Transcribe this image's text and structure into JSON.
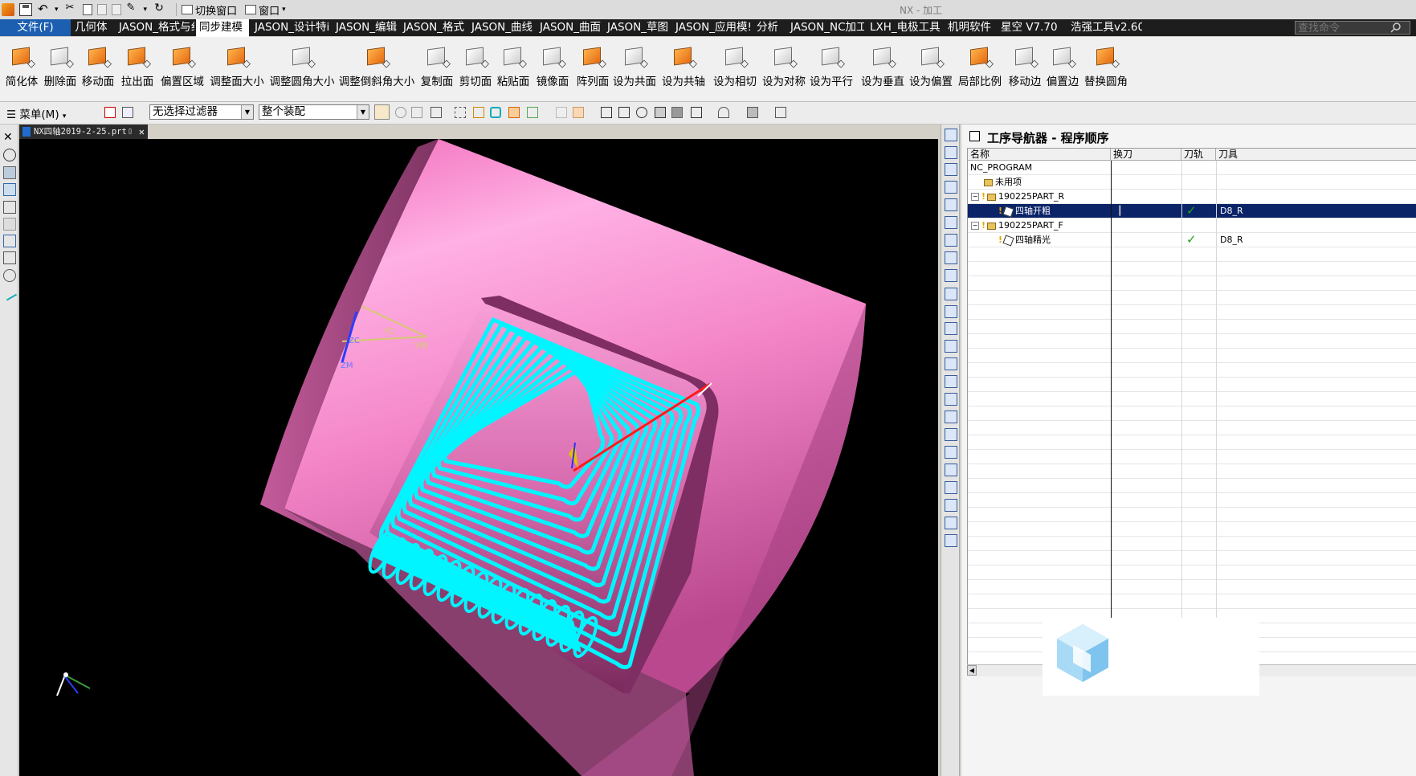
{
  "titlebar": {
    "switch_window_label": "切换窗口",
    "window_label": "窗口",
    "app_title": "NX - 加工"
  },
  "ribbon_tabs": [
    {
      "label": "文件(F)",
      "name": "tab-file"
    },
    {
      "label": "几何体",
      "name": "tab-geometry"
    },
    {
      "label": "JASON_格式与纟",
      "name": "tab-jason-format-and"
    },
    {
      "label": "同步建模",
      "name": "tab-synchronous-modeling",
      "active": true
    },
    {
      "label": "JASON_设计特i",
      "name": "tab-jason-design-feature"
    },
    {
      "label": "JASON_编辑",
      "name": "tab-jason-edit"
    },
    {
      "label": "JASON_格式",
      "name": "tab-jason-format"
    },
    {
      "label": "JASON_曲线",
      "name": "tab-jason-curve"
    },
    {
      "label": "JASON_曲面",
      "name": "tab-jason-surface"
    },
    {
      "label": "JASON_草图",
      "name": "tab-jason-sketch"
    },
    {
      "label": "JASON_应用模!",
      "name": "tab-jason-application"
    },
    {
      "label": "分析",
      "name": "tab-analysis"
    },
    {
      "label": "JASON_NC加工",
      "name": "tab-jason-nc"
    },
    {
      "label": "LXH_电极工具",
      "name": "tab-lxh-electrode"
    },
    {
      "label": "机明软件",
      "name": "tab-jiming"
    },
    {
      "label": "星空 V7.70",
      "name": "tab-xingkong"
    },
    {
      "label": "浩强工具v2.60",
      "name": "tab-haoqiang"
    }
  ],
  "search": {
    "placeholder": "查找命令"
  },
  "ribbon_commands": [
    {
      "label": "简化体",
      "name": "simplify-body-button"
    },
    {
      "label": "删除面",
      "name": "delete-face-button"
    },
    {
      "label": "移动面",
      "name": "move-face-button"
    },
    {
      "label": "拉出面",
      "name": "pull-face-button"
    },
    {
      "label": "偏置区域",
      "name": "offset-region-button"
    },
    {
      "label": "调整面大小",
      "name": "resize-face-button"
    },
    {
      "label": "调整圆角大小",
      "name": "resize-blend-button"
    },
    {
      "label": "调整倒斜角大小",
      "name": "resize-chamfer-button"
    },
    {
      "label": "复制面",
      "name": "copy-face-button"
    },
    {
      "label": "剪切面",
      "name": "cut-face-button"
    },
    {
      "label": "粘贴面",
      "name": "paste-face-button"
    },
    {
      "label": "镜像面",
      "name": "mirror-face-button"
    },
    {
      "label": "阵列面",
      "name": "pattern-face-button"
    },
    {
      "label": "设为共面",
      "name": "make-coplanar-button"
    },
    {
      "label": "设为共轴",
      "name": "make-coaxial-button"
    },
    {
      "label": "设为相切",
      "name": "make-tangent-button"
    },
    {
      "label": "设为对称",
      "name": "make-symmetric-button"
    },
    {
      "label": "设为平行",
      "name": "make-parallel-button"
    },
    {
      "label": "设为垂直",
      "name": "make-perpendicular-button"
    },
    {
      "label": "设为偏置",
      "name": "make-offset-button"
    },
    {
      "label": "局部比例",
      "name": "local-scale-button"
    },
    {
      "label": "移动边",
      "name": "move-edge-button"
    },
    {
      "label": "偏置边",
      "name": "offset-edge-button"
    },
    {
      "label": "替换圆角",
      "name": "replace-blend-button"
    }
  ],
  "selection_bar": {
    "menu_label": "菜单(M)",
    "filter_value": "无选择过滤器",
    "scope_value": "整个装配"
  },
  "document_tab": {
    "label": "NX四轴2019-2-25.prt"
  },
  "navigator": {
    "title": "工序导航器 - 程序顺序",
    "columns": [
      "名称",
      "换刀",
      "刀轨",
      "刀具"
    ],
    "rows": [
      {
        "name": "NC_PROGRAM",
        "tool_change": "",
        "toolpath": "",
        "tool": ""
      },
      {
        "name": "未用项",
        "tool_change": "",
        "toolpath": "",
        "tool": ""
      },
      {
        "name": "190225PART_R",
        "tool_change": "",
        "toolpath": "",
        "tool": ""
      },
      {
        "name": "四轴开粗",
        "tool_change": "",
        "toolpath": "✓",
        "tool": "D8_R"
      },
      {
        "name": "190225PART_F",
        "tool_change": "",
        "toolpath": "",
        "tool": ""
      },
      {
        "name": "四轴精光",
        "tool_change": "",
        "toolpath": "✓",
        "tool": "D8_R"
      }
    ]
  },
  "viewport": {
    "axis_labels": {
      "yc": "YC",
      "zc": "ZC",
      "ym": "YM",
      "zm": "ZM"
    },
    "colors": {
      "part": "#f07ec4",
      "toolpath": "#00f5ff",
      "tool_axis": "#ff0000",
      "background": "#000000"
    }
  }
}
